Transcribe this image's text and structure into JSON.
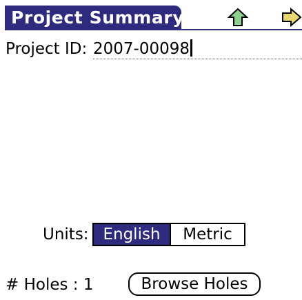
{
  "header": {
    "title": "Project Summary",
    "icons": {
      "up": "up-arrow-icon",
      "next": "right-arrow-icon"
    },
    "accent_color": "#2e2a7e"
  },
  "project": {
    "id_label": "Project ID:",
    "id_value": "2007-00098"
  },
  "units": {
    "label": "Units:",
    "options": [
      "English",
      "Metric"
    ],
    "selected": "English"
  },
  "holes": {
    "label": "# Holes : 1",
    "browse_label": "Browse Holes"
  }
}
